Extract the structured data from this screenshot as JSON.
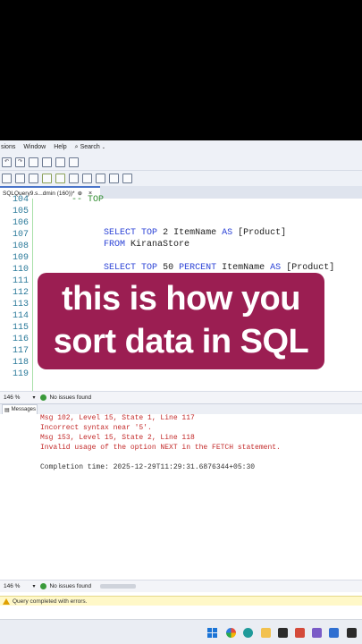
{
  "menubar": {
    "items": [
      "sions",
      "Window",
      "Help"
    ],
    "search": "Search"
  },
  "tab": {
    "title": "SQLQuery9.s...dmin (160))*",
    "pin": "⊕",
    "close": "×"
  },
  "editor": {
    "lines": [
      {
        "num": "104",
        "text": "-- TOP"
      },
      {
        "num": "105",
        "text": ""
      },
      {
        "num": "106",
        "text": ""
      },
      {
        "num": "107",
        "text": "SELECT TOP 2 ItemName AS [Product]"
      },
      {
        "num": "108",
        "text": "FROM KiranaStore"
      },
      {
        "num": "109",
        "text": ""
      },
      {
        "num": "110",
        "text": "SELECT TOP 50 PERCENT ItemName AS [Product]"
      },
      {
        "num": "111",
        "text": ""
      },
      {
        "num": "112",
        "text": ""
      },
      {
        "num": "113",
        "text": ""
      },
      {
        "num": "114",
        "text": ""
      },
      {
        "num": "115",
        "text": ""
      },
      {
        "num": "116",
        "text": ""
      },
      {
        "num": "117",
        "text": ""
      },
      {
        "num": "118",
        "text": ""
      },
      {
        "num": "119",
        "text": ""
      }
    ]
  },
  "overlay": {
    "line1": "this is how you",
    "line2": "sort data in SQL"
  },
  "status": {
    "zoom": "146 %",
    "issues": "No issues found"
  },
  "messages_tab": "Messages",
  "messages": [
    {
      "text": "Msg 102, Level 15, State 1, Line 117",
      "type": "error"
    },
    {
      "text": "Incorrect syntax near '5'.",
      "type": "error"
    },
    {
      "text": "Msg 153, Level 15, State 2, Line 118",
      "type": "error"
    },
    {
      "text": "Invalid usage of the option NEXT in the FETCH statement.",
      "type": "error"
    },
    {
      "text": "",
      "type": "blank"
    },
    {
      "text": "Completion time: 2025-12-29T11:29:31.6876344+05:30",
      "type": "info"
    }
  ],
  "status2": {
    "zoom": "146 %",
    "issues": "No issues found"
  },
  "query_status": "Query completed with errors.",
  "colors": {
    "overlay": "#9b1e52",
    "keyword": "#2a41d6",
    "error": "#c32a2a",
    "line_numbers": "#2b7a9a"
  }
}
